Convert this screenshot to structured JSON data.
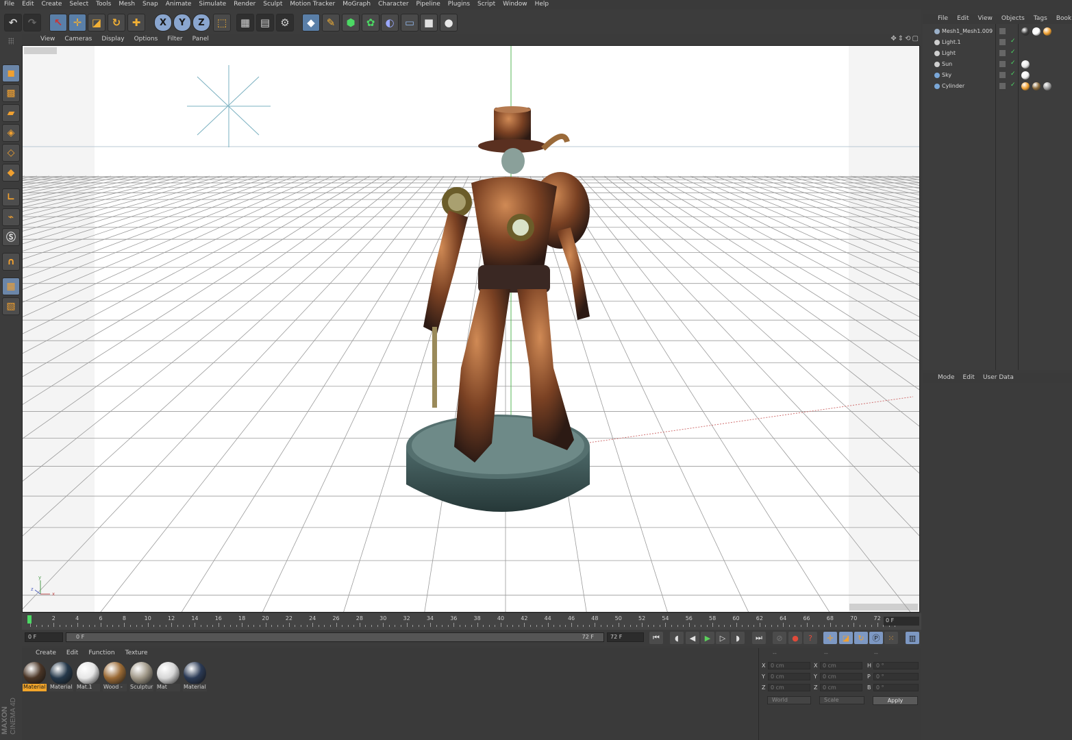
{
  "menubar": {
    "items": [
      "File",
      "Edit",
      "Create",
      "Select",
      "Tools",
      "Mesh",
      "Snap",
      "Animate",
      "Simulate",
      "Render",
      "Sculpt",
      "Motion Tracker",
      "MoGraph",
      "Character",
      "Pipeline",
      "Plugins",
      "Script",
      "Window",
      "Help"
    ]
  },
  "toolbar": {
    "axis_x": "X",
    "axis_y": "Y",
    "axis_z": "Z"
  },
  "viewport": {
    "menu": [
      "View",
      "Cameras",
      "Display",
      "Options",
      "Filter",
      "Panel"
    ],
    "axis_x": "x",
    "axis_y": "y",
    "axis_z": "z"
  },
  "timeline": {
    "ticks": [
      "0",
      "2",
      "4",
      "6",
      "8",
      "10",
      "12",
      "14",
      "16",
      "18",
      "20",
      "22",
      "24",
      "26",
      "28",
      "30",
      "32",
      "34",
      "36",
      "38",
      "40",
      "42",
      "44",
      "46",
      "48",
      "50",
      "52",
      "54",
      "56",
      "58",
      "60",
      "62",
      "64",
      "66",
      "68",
      "70",
      "72"
    ],
    "current_frame": "0 F",
    "start_field": "0 F",
    "range_start": "0 F",
    "range_end": "72 F",
    "end_field": "72 F"
  },
  "materials": {
    "menu": [
      "Create",
      "Edit",
      "Function",
      "Texture"
    ],
    "items": [
      {
        "label": "Material",
        "color": "#4a3526"
      },
      {
        "label": "Material",
        "color": "#25384a"
      },
      {
        "label": "Mat.1",
        "color": "#e6e6e6"
      },
      {
        "label": "Wood -",
        "color": "#9a6a35"
      },
      {
        "label": "Sculptur",
        "color": "#a09888"
      },
      {
        "label": "Mat",
        "color": "#d6d6d6"
      },
      {
        "label": "Material",
        "color": "#2b3a55"
      }
    ]
  },
  "coordinates": {
    "header": [
      "--",
      "--",
      "--"
    ],
    "rows": [
      {
        "a": "X",
        "av": "0 cm",
        "b": "X",
        "bv": "0 cm",
        "c": "H",
        "cv": "0 °"
      },
      {
        "a": "Y",
        "av": "0 cm",
        "b": "Y",
        "bv": "0 cm",
        "c": "P",
        "cv": "0 °"
      },
      {
        "a": "Z",
        "av": "0 cm",
        "b": "Z",
        "bv": "0 cm",
        "c": "B",
        "cv": "0 °"
      }
    ],
    "space": "World",
    "mode": "Scale",
    "apply": "Apply"
  },
  "objects": {
    "menu": [
      "File",
      "Edit",
      "View",
      "Objects",
      "Tags",
      "Bookmark"
    ],
    "items": [
      {
        "name": "Mesh1_Mesh1.009",
        "icon_color": "#9bb0c8"
      },
      {
        "name": "Light.1",
        "icon_color": "#cfcfcf"
      },
      {
        "name": "Light",
        "icon_color": "#cfcfcf"
      },
      {
        "name": "Sun",
        "icon_color": "#cfcfcf"
      },
      {
        "name": "Sky",
        "icon_color": "#7aa7d8"
      },
      {
        "name": "Cylinder",
        "icon_color": "#7aa7d8"
      }
    ]
  },
  "attributes": {
    "menu": [
      "Mode",
      "Edit",
      "User Data"
    ]
  },
  "branding": {
    "maxon": "MAXON",
    "product": "CINEMA 4D"
  }
}
